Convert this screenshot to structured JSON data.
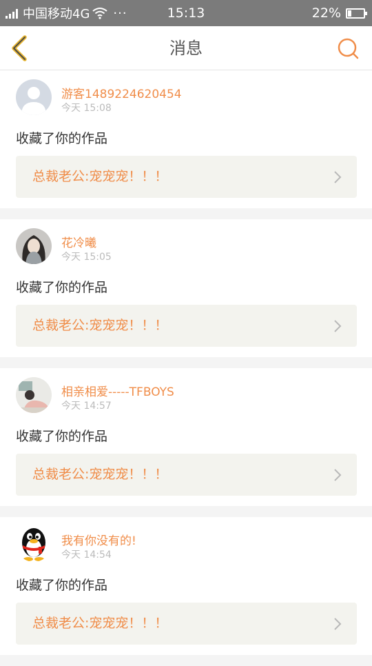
{
  "status_bar": {
    "carrier": "中国移动4G",
    "dots": "···",
    "time": "15:13",
    "battery_text": "22%",
    "battery_level": 0.22
  },
  "header": {
    "title": "消息",
    "back_icon": "chevron-left-icon",
    "search_icon": "search-icon"
  },
  "accent_color": "#f08d49",
  "messages": [
    {
      "user": "游客1489224620454",
      "time": "今天 15:08",
      "action": "收藏了你的作品",
      "work": "总裁老公:宠宠宠！！！",
      "avatar": "default-avatar"
    },
    {
      "user": "花冷曦",
      "time": "今天 15:05",
      "action": "收藏了你的作品",
      "work": "总裁老公:宠宠宠！！！",
      "avatar": "photo-avatar"
    },
    {
      "user": "相亲相爱-----TFBOYS",
      "time": "今天 14:57",
      "action": "收藏了你的作品",
      "work": "总裁老公:宠宠宠！！！",
      "avatar": "photo-avatar"
    },
    {
      "user": "我有你没有的!",
      "time": "今天 14:54",
      "action": "收藏了你的作品",
      "work": "总裁老公:宠宠宠！！！",
      "avatar": "penguin-avatar"
    }
  ]
}
